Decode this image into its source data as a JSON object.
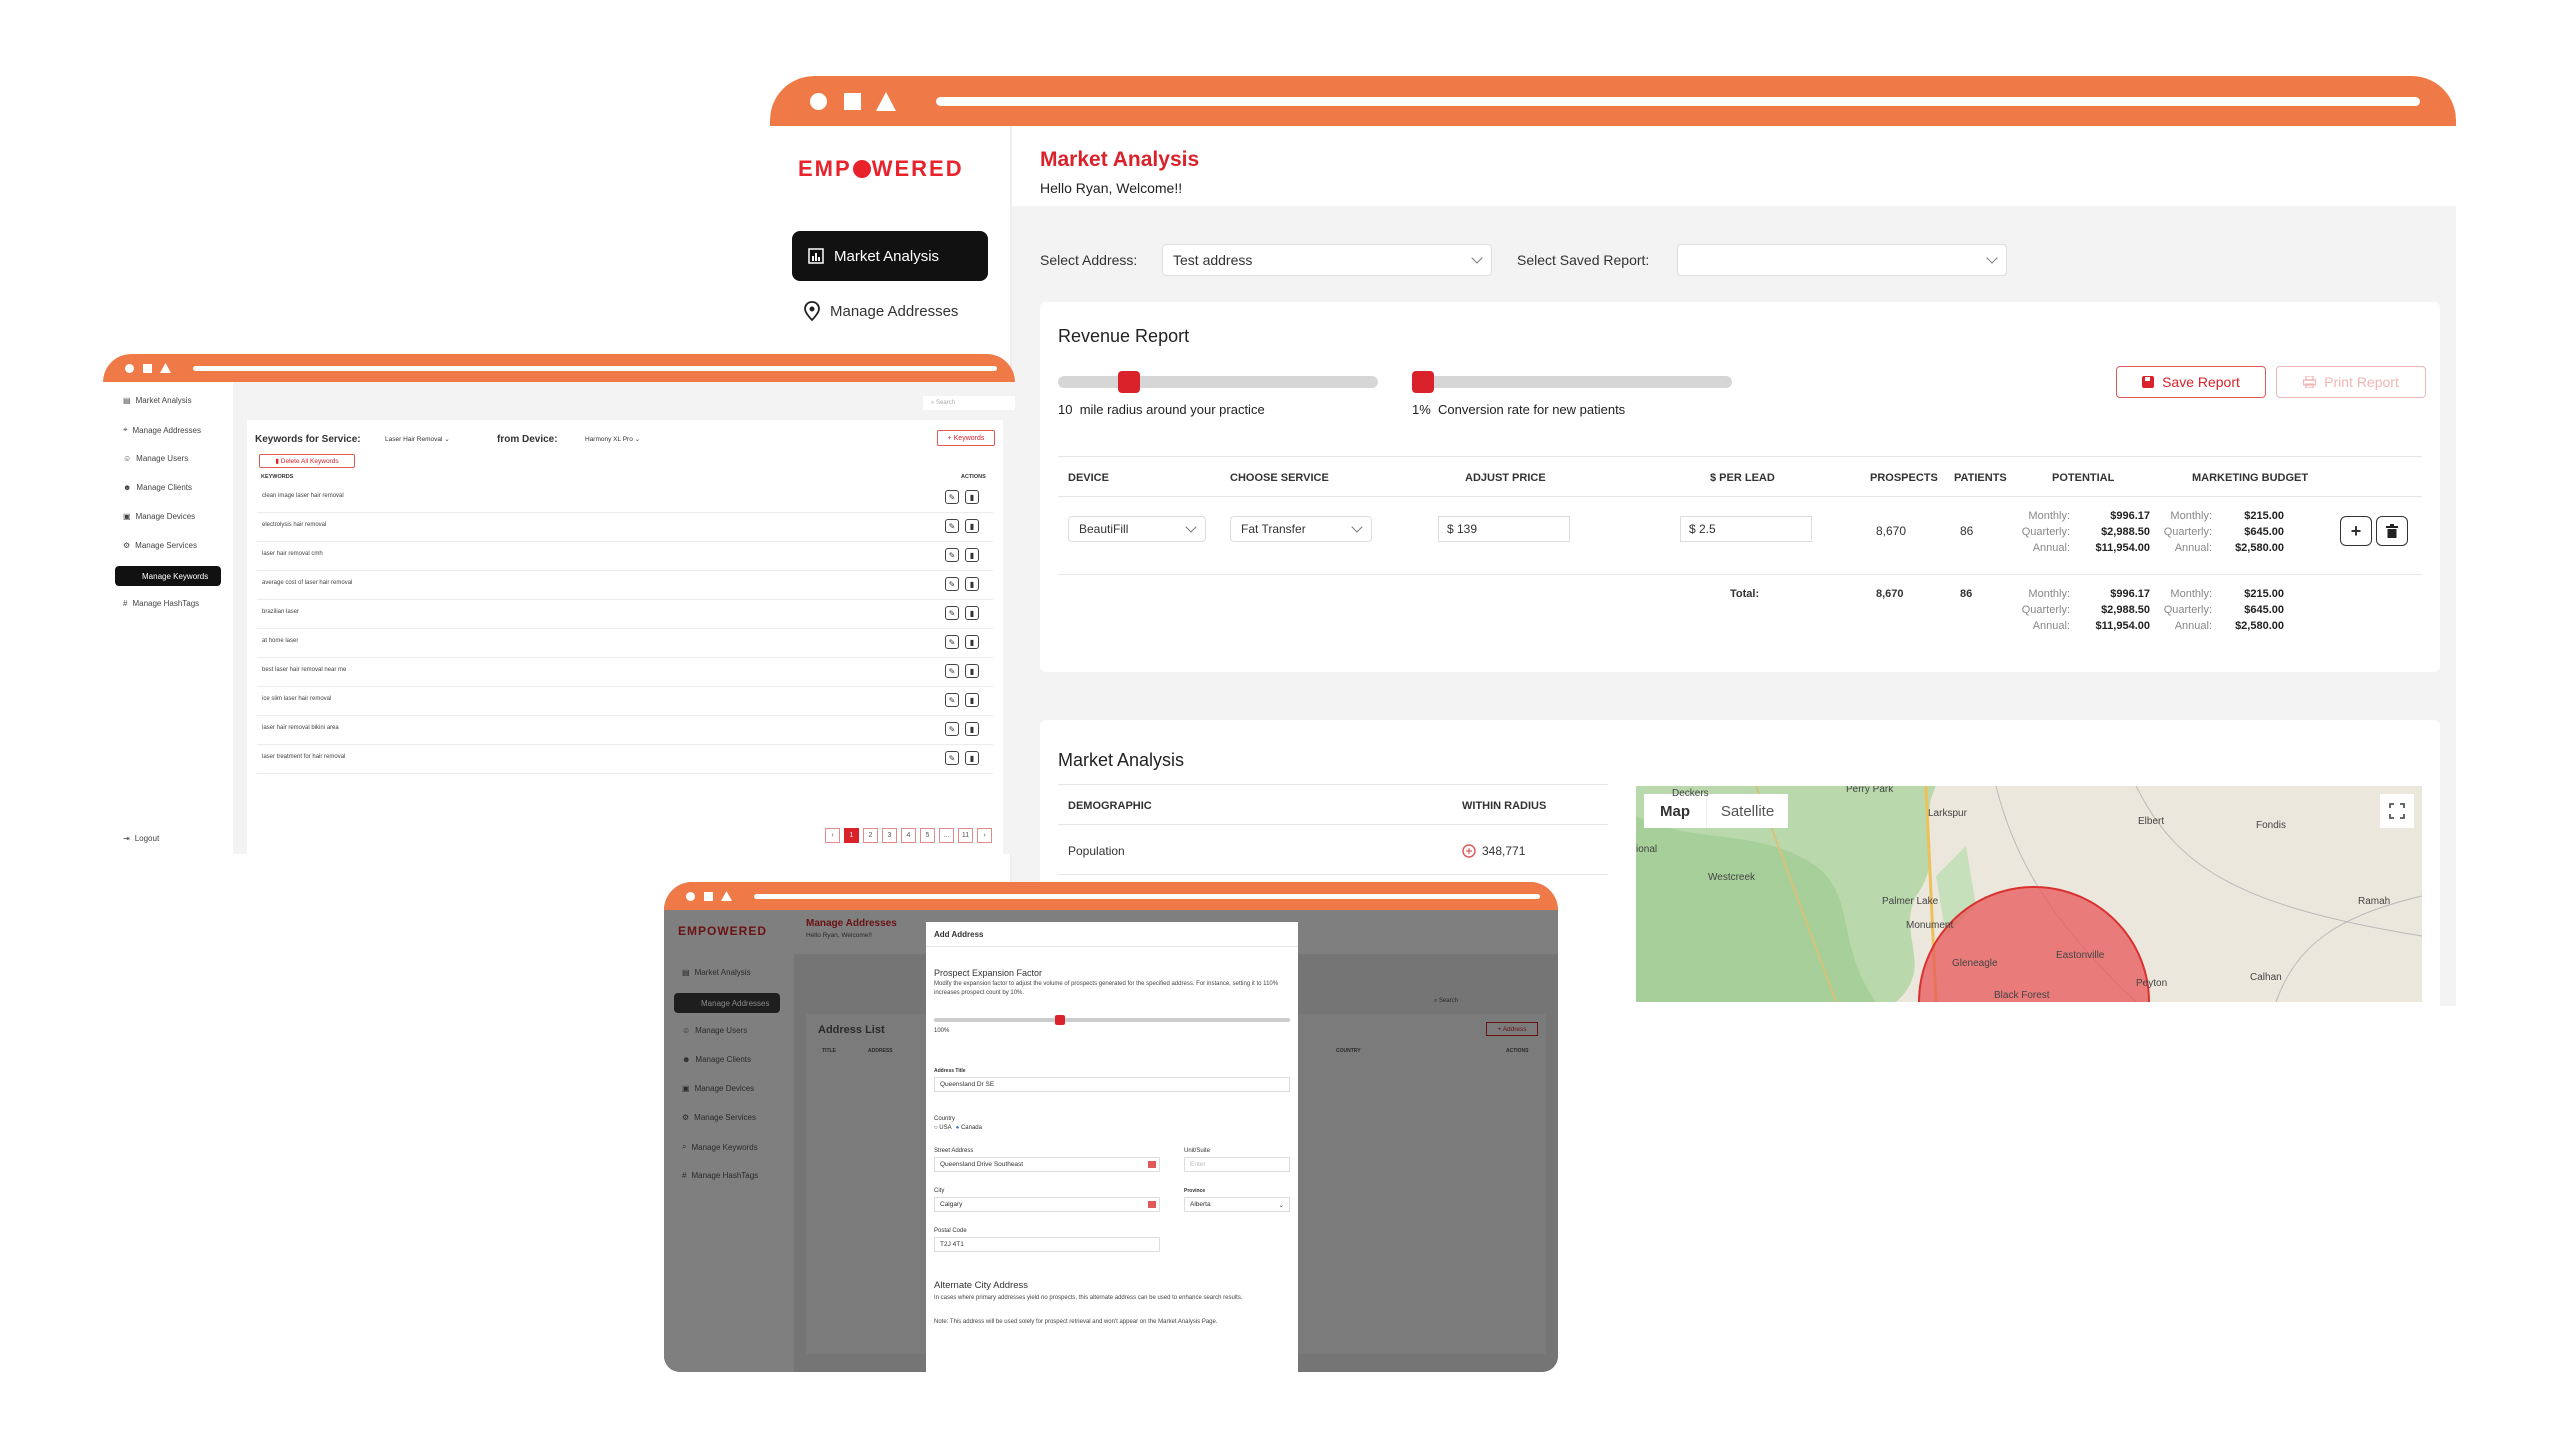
{
  "brand": {
    "logo": "EMPOWERED",
    "accent": "#f07a47",
    "red": "#d9222a"
  },
  "main_window": {
    "nav": [
      {
        "label": "Market Analysis",
        "icon": "chart-icon",
        "active": true
      },
      {
        "label": "Manage Addresses",
        "icon": "location-pin-icon",
        "active": false
      }
    ],
    "page_title": "Market Analysis",
    "greeting": "Hello Ryan, Welcome!!",
    "select_address_label": "Select Address:",
    "select_address_value": "Test address",
    "saved_report_label": "Select Saved Report:",
    "saved_report_value": "",
    "revenue": {
      "title": "Revenue Report",
      "radius_value": "10",
      "radius_text": "mile radius around your practice",
      "radius_level": 0.2,
      "conversion_value": "1%",
      "conversion_text": "Conversion rate for new patients",
      "conversion_level": 0.0,
      "save_btn": "Save Report",
      "print_btn": "Print Report",
      "headers": [
        "DEVICE",
        "CHOOSE SERVICE",
        "ADJUST PRICE",
        "$ PER LEAD",
        "PROSPECTS",
        "PATIENTS",
        "POTENTIAL",
        "MARKETING BUDGET"
      ],
      "row": {
        "device": "BeautiFill",
        "service": "Fat Transfer",
        "price": "$ 139",
        "per_lead": "$ 2.5",
        "prospects": "8,670",
        "patients": "86",
        "potential": [
          [
            "Monthly:",
            "$996.17"
          ],
          [
            "Quarterly:",
            "$2,988.50"
          ],
          [
            "Annual:",
            "$11,954.00"
          ]
        ],
        "budget": [
          [
            "Monthly:",
            "$215.00"
          ],
          [
            "Quarterly:",
            "$645.00"
          ],
          [
            "Annual:",
            "$2,580.00"
          ]
        ]
      },
      "total": {
        "label": "Total:",
        "prospects": "8,670",
        "patients": "86",
        "potential": [
          [
            "Monthly:",
            "$996.17"
          ],
          [
            "Quarterly:",
            "$2,988.50"
          ],
          [
            "Annual:",
            "$11,954.00"
          ]
        ],
        "budget": [
          [
            "Monthly:",
            "$215.00"
          ],
          [
            "Quarterly:",
            "$645.00"
          ],
          [
            "Annual:",
            "$2,580.00"
          ]
        ]
      }
    },
    "market": {
      "title": "Market Analysis",
      "headers": [
        "DEMOGRAPHIC",
        "WITHIN RADIUS"
      ],
      "rows": [
        [
          "Population",
          "348,771"
        ]
      ],
      "map_tabs": [
        "Map",
        "Satellite"
      ],
      "towns": [
        "Perry Park",
        "Larkspur",
        "Elbert",
        "Fondis",
        "Westcreek",
        "Palmer Lake",
        "Monument",
        "Gleneagle",
        "Eastonville",
        "Black Forest",
        "Peyton",
        "Calhan",
        "Ramah",
        "Deckers",
        "ional"
      ]
    }
  },
  "keywords_window": {
    "nav": [
      "Market Analysis",
      "Manage Addresses",
      "Manage Users",
      "Manage Clients",
      "Manage Devices",
      "Manage Services",
      "Manage Keywords",
      "Manage HashTags"
    ],
    "active_index": 6,
    "logout": "Logout",
    "search_placeholder": "Search",
    "heading": "Keywords for Service:",
    "service_value": "Laser Hair Removal",
    "from_device_label": "from Device:",
    "device_value": "Harmony XL Pro",
    "add_btn": "+ Keywords",
    "delete_btn": "Delete All Keywords",
    "col_keywords": "KEYWORDS",
    "col_actions": "ACTIONS",
    "keywords": [
      "clean image laser hair removal",
      "electrolysis hair removal",
      "laser hair removal cmh",
      "average cost of laser hair removal",
      "brazilian laser",
      "at home laser",
      "best laser hair removal near me",
      "ice slim laser hair removal",
      "laser hair removal bikini area",
      "laser treatment for hair removal"
    ],
    "pages": [
      "‹",
      "1",
      "2",
      "3",
      "4",
      "5",
      "...",
      "11",
      "›"
    ]
  },
  "address_window": {
    "logo": "EMPOWERED",
    "nav": [
      "Market Analysis",
      "Manage Addresses",
      "Manage Users",
      "Manage Clients",
      "Manage Devices",
      "Manage Services",
      "Manage Keywords",
      "Manage HashTags"
    ],
    "page_title": "Manage Addresses",
    "greeting": "Hello Ryan, Welcome!!",
    "list_title": "Address List",
    "add_btn": "+ Address",
    "search_placeholder": "Search",
    "cols": [
      "TITLE",
      "ADDRESS",
      "COUNTRY",
      "ACTIONS"
    ],
    "modal": {
      "title": "Add Address",
      "factor_title": "Prospect Expansion Factor",
      "factor_desc": "Modify the expansion factor to adjust the volume of prospects generated for the specified address. For instance, setting it to 110% increases prospect count by 10%.",
      "factor_value": "100%",
      "factor_level": 0.35,
      "address_title_label": "Address Title",
      "address_title_value": "Queensland Dr SE",
      "country_label": "Country",
      "country_options": [
        "USA",
        "Canada"
      ],
      "street_label": "Street Address",
      "street_value": "Queensland Drive Southeast",
      "unit_label": "Unit/Suite",
      "unit_placeholder": "Enter",
      "city_label": "City",
      "city_value": "Calgary",
      "province_label": "Province",
      "province_value": "Alberta",
      "postal_label": "Postal Code",
      "postal_value": "T2J 4T1",
      "alt_title": "Alternate City Address",
      "alt_desc": "In cases where primary addresses yield no prospects, this alternate address can be used to enhance search results.",
      "alt_note": "Note: This address will be used solely for prospect retrieval and won't appear on the Market Analysis Page."
    }
  }
}
